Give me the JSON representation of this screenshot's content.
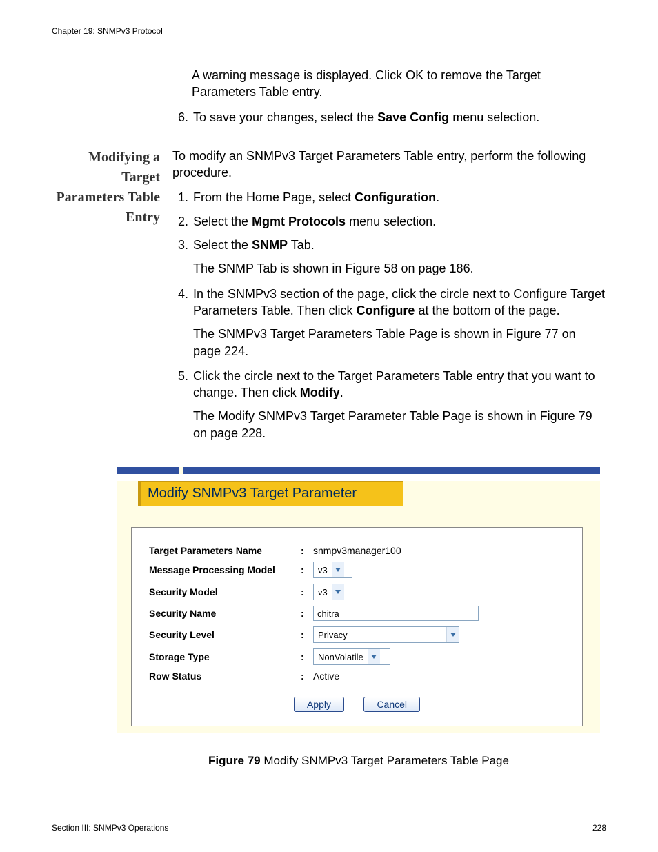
{
  "header": {
    "chapter_line": "Chapter 19: SNMPv3 Protocol"
  },
  "intro_block": {
    "warning_para": "A warning message is displayed. Click OK to remove the Target Parameters Table entry.",
    "step6_pre": "To save your changes, select the ",
    "step6_bold": "Save Config",
    "step6_post": " menu selection."
  },
  "side_heading": "Modifying a Target Parameters Table Entry",
  "main": {
    "lead_para": "To modify an SNMPv3 Target Parameters Table entry, perform the following procedure.",
    "steps": {
      "s1_pre": "From the Home Page, select ",
      "s1_bold": "Configuration",
      "s1_post": ".",
      "s2_pre": "Select the ",
      "s2_bold": "Mgmt Protocols",
      "s2_post": " menu selection.",
      "s3_pre": "Select the ",
      "s3_bold": "SNMP",
      "s3_post": " Tab.",
      "s3_sub": "The SNMP Tab is shown in Figure 58 on page 186.",
      "s4_pre": "In the SNMPv3 section of the page, click the circle next to Configure Target Parameters Table. Then click ",
      "s4_bold": "Configure",
      "s4_post": " at the bottom of the page.",
      "s4_sub": "The SNMPv3 Target Parameters Table Page is shown in Figure 77 on page 224.",
      "s5_pre": "Click the circle next to the Target Parameters Table entry that you want to change. Then click ",
      "s5_bold": "Modify",
      "s5_post": ".",
      "s5_sub": "The Modify SNMPv3 Target Parameter Table Page is shown in Figure 79 on page 228."
    }
  },
  "figure": {
    "banner_title": "Modify SNMPv3 Target Parameter",
    "rows": {
      "target_name_label": "Target Parameters Name",
      "target_name_value": "snmpv3manager100",
      "mpm_label": "Message Processing Model",
      "mpm_value": "v3",
      "sec_model_label": "Security Model",
      "sec_model_value": "v3",
      "sec_name_label": "Security Name",
      "sec_name_value": "chitra",
      "sec_level_label": "Security Level",
      "sec_level_value": "Privacy",
      "storage_label": "Storage Type",
      "storage_value": "NonVolatile",
      "row_status_label": "Row Status",
      "row_status_value": "Active"
    },
    "buttons": {
      "apply": "Apply",
      "cancel": "Cancel"
    },
    "caption_bold": "Figure 79",
    "caption_rest": "  Modify SNMPv3 Target Parameters Table Page"
  },
  "footer": {
    "section_line": "Section III: SNMPv3 Operations",
    "page_no": "228"
  }
}
